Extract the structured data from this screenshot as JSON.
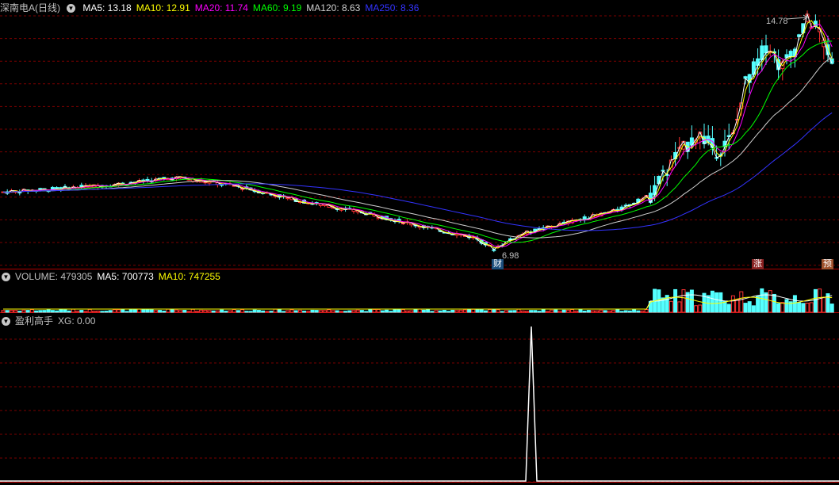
{
  "price_panel": {
    "stock_title": "深南电A(日线)",
    "ma_labels": [
      {
        "key": "MA5",
        "text": "MA5: 13.18",
        "color": "#ffffff"
      },
      {
        "key": "MA10",
        "text": "MA10: 12.91",
        "color": "#ffff00"
      },
      {
        "key": "MA20",
        "text": "MA20: 11.74",
        "color": "#ff00ff"
      },
      {
        "key": "MA60",
        "text": "MA60: 9.19",
        "color": "#00ff00"
      },
      {
        "key": "MA120",
        "text": "MA120: 8.63",
        "color": "#d0d0d0"
      },
      {
        "key": "MA250",
        "text": "MA250: 8.36",
        "color": "#3333ff"
      }
    ],
    "high_label": "14.78",
    "low_label": "6.98",
    "markers": {
      "cai": "财",
      "zhang": "涨",
      "yu": "预"
    }
  },
  "volume_panel": {
    "volume_text": "VOLUME: 479305",
    "ma5_text": "MA5: 700773",
    "ma10_text": "MA10: 747255"
  },
  "indicator_panel": {
    "name": "盈利高手",
    "xg_text": "XG: 0.00"
  },
  "colors": {
    "up": "#ff3232",
    "down": "#54ffff",
    "grid": "#7a0000",
    "label_gray": "#c0c0c0",
    "volume_yellow": "#ffff00"
  },
  "chart_data": {
    "type": "candlestick",
    "price_range": [
      6.98,
      14.78
    ],
    "period": "daily",
    "candles_ohlc": [],
    "ma_last_values": {
      "MA5": 13.18,
      "MA10": 12.91,
      "MA20": 11.74,
      "MA60": 9.19,
      "MA120": 8.63,
      "MA250": 8.36
    },
    "volume_last": 479305,
    "volume_ma": {
      "MA5": 700773,
      "MA10": 747255
    },
    "indicator_xg_last": 0.0
  }
}
